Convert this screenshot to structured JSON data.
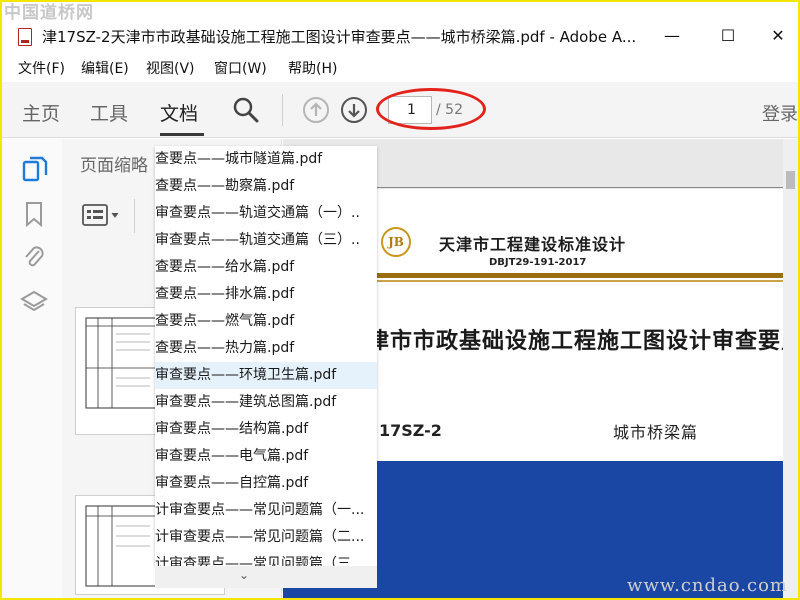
{
  "watermarks": {
    "top": "中国道桥网",
    "bottom": "www.cndao.com"
  },
  "window": {
    "title": "津17SZ-2天津市市政基础设施工程施工图设计审查要点——城市桥梁篇.pdf - Adobe A...",
    "minimize": "—",
    "maximize": "☐",
    "close": "✕"
  },
  "menu": [
    "文件(F)",
    "编辑(E)",
    "视图(V)",
    "窗口(W)",
    "帮助(H)"
  ],
  "toolbar": {
    "tabs": [
      "主页",
      "工具",
      "文档"
    ],
    "page_current": "1",
    "page_total": "/ 52",
    "login": "登录"
  },
  "thumbnails": {
    "title": "页面缩略"
  },
  "dropdown": {
    "items": [
      "查要点——城市隧道篇.pdf",
      "查要点——勘察篇.pdf",
      "审查要点——轨道交通篇（一）..",
      "审查要点——轨道交通篇（三）..",
      "查要点——给水篇.pdf",
      "查要点——排水篇.pdf",
      "查要点——燃气篇.pdf",
      "查要点——热力篇.pdf",
      "审查要点——环境卫生篇.pdf",
      "审查要点——建筑总图篇.pdf",
      "审查要点——结构篇.pdf",
      "审查要点——电气篇.pdf",
      "审查要点——自控篇.pdf",
      "计审查要点——常见问题篇（一...",
      "计审查要点——常见问题篇（二...",
      "计审查要点——常见问题篇（三..."
    ],
    "hover_index": 8
  },
  "document": {
    "logo": "JB",
    "org": "天津市工程建设标准设计",
    "code": "DBJT29-191-2017",
    "heading": "津市市政基础设施工程施工图设计审查要点",
    "number": "17SZ-2",
    "subtitle": "城市桥梁篇"
  },
  "colors": {
    "accent_blue": "#1b47a4",
    "annotation_red": "#e3231b",
    "gold": "#9b6d11",
    "frame_yellow": "#f5e600"
  }
}
